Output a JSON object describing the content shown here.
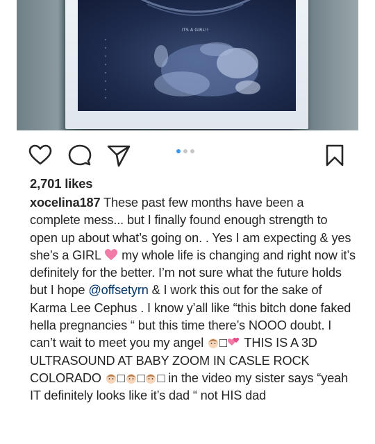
{
  "post": {
    "image": {
      "label": "ITS A GIRL!!"
    },
    "actions": {
      "like_icon": "heart-icon",
      "comment_icon": "comment-icon",
      "share_icon": "send-icon",
      "save_icon": "bookmark-icon"
    },
    "carousel": {
      "total": 3,
      "active_index": 0
    },
    "likes": "2,701 likes",
    "caption": {
      "username": "xocelina187",
      "part1": " These past few months have been a complete mess... but I finally found enough strength to open up about what’s going on. . Yes I am expecting & yes she’s a GIRL ",
      "part2": " my whole life is changing and right now it’s definitely for the better. I’m not sure what the future holds but I hope ",
      "mention": "@offsetyrn",
      "part3": " & I work this out for the sake of Karma Lee Cephus . I know y’all like “this bitch done faked hella pregnancies “ but this time there’s NOOO doubt. I can’t wait to meet you my angel ",
      "part4": " THIS IS A 3D ULTRASOUND AT BABY ZOOM IN CASLE ROCK COLORADO ",
      "part5": " in the video my sister says “yeah IT definitely looks like it’s dad “ not HIS dad"
    },
    "colors": {
      "accent": "#3897f0",
      "mention": "#003569",
      "text": "#262626",
      "heart_emoji": "#f06292"
    }
  }
}
